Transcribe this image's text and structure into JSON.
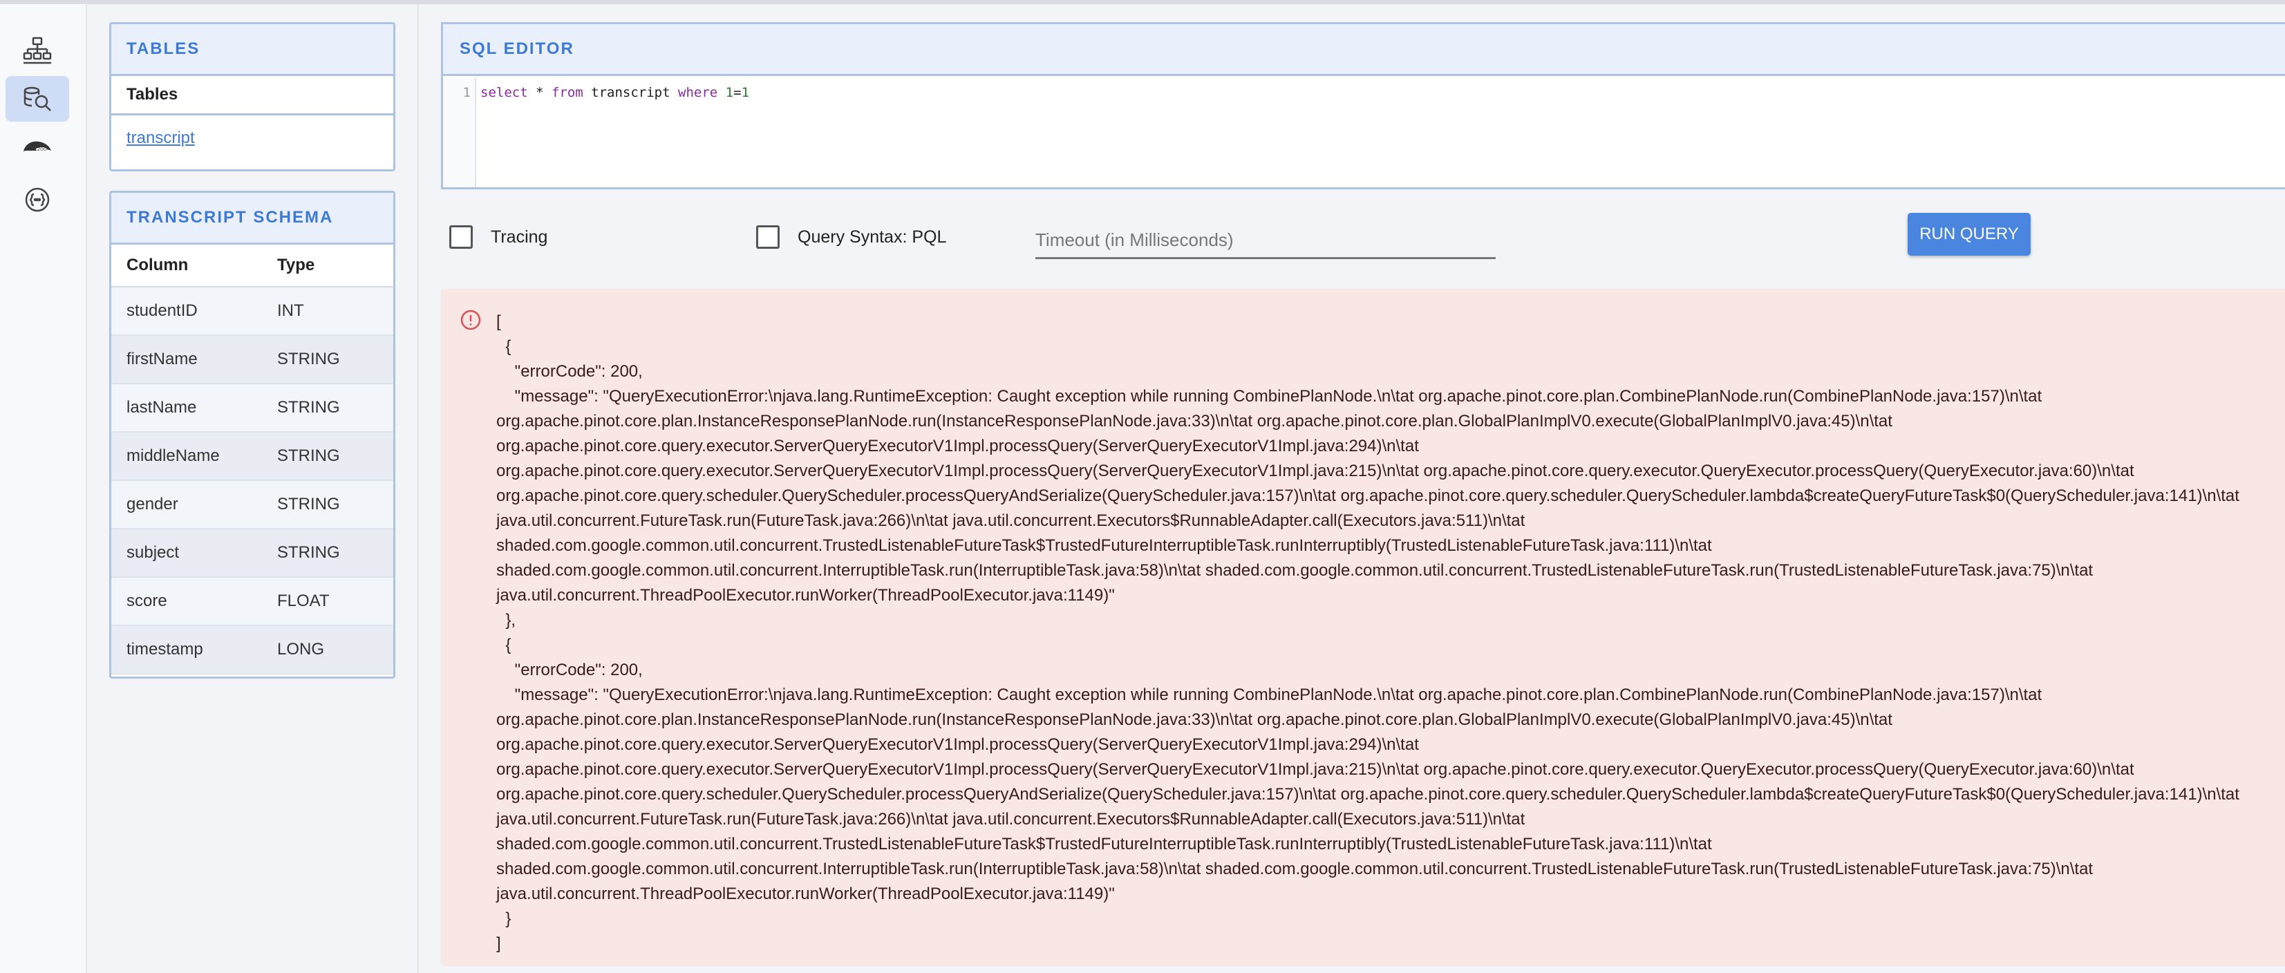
{
  "rail": {
    "items": [
      {
        "icon": "cluster-icon"
      },
      {
        "icon": "query-console-icon",
        "active": true
      },
      {
        "icon": "zookeeper-icon"
      },
      {
        "icon": "api-icon"
      }
    ]
  },
  "tables_panel": {
    "title": "TABLES",
    "subheader": "Tables",
    "items": [
      "transcript"
    ]
  },
  "schema_panel": {
    "title": "TRANSCRIPT SCHEMA",
    "columns": [
      "Column",
      "Type"
    ],
    "rows": [
      [
        "studentID",
        "INT"
      ],
      [
        "firstName",
        "STRING"
      ],
      [
        "lastName",
        "STRING"
      ],
      [
        "middleName",
        "STRING"
      ],
      [
        "gender",
        "STRING"
      ],
      [
        "subject",
        "STRING"
      ],
      [
        "score",
        "FLOAT"
      ],
      [
        "timestamp",
        "LONG"
      ]
    ]
  },
  "editor": {
    "title": "SQL EDITOR",
    "line_number": "1",
    "query": {
      "t1": "select",
      "t2": " * ",
      "t3": "from",
      "t4": " transcript ",
      "t5": "where",
      "t6": " ",
      "t7": "1",
      "t8": "=",
      "t9": "1"
    }
  },
  "options": {
    "tracing_label": "Tracing",
    "tracing_checked": false,
    "syntax_label": "Query Syntax: PQL",
    "syntax_checked": false,
    "timeout_placeholder": "Timeout (in Milliseconds)",
    "run_label": "RUN QUERY"
  },
  "error": {
    "icon": "error-circle-icon",
    "text": "[\n  {\n    \"errorCode\": 200,\n    \"message\": \"QueryExecutionError:\\njava.lang.RuntimeException: Caught exception while running CombinePlanNode.\\n\\tat org.apache.pinot.core.plan.CombinePlanNode.run(CombinePlanNode.java:157)\\n\\tat\norg.apache.pinot.core.plan.InstanceResponsePlanNode.run(InstanceResponsePlanNode.java:33)\\n\\tat org.apache.pinot.core.plan.GlobalPlanImplV0.execute(GlobalPlanImplV0.java:45)\\n\\tat\norg.apache.pinot.core.query.executor.ServerQueryExecutorV1Impl.processQuery(ServerQueryExecutorV1Impl.java:294)\\n\\tat\norg.apache.pinot.core.query.executor.ServerQueryExecutorV1Impl.processQuery(ServerQueryExecutorV1Impl.java:215)\\n\\tat org.apache.pinot.core.query.executor.QueryExecutor.processQuery(QueryExecutor.java:60)\\n\\tat\norg.apache.pinot.core.query.scheduler.QueryScheduler.processQueryAndSerialize(QueryScheduler.java:157)\\n\\tat org.apache.pinot.core.query.scheduler.QueryScheduler.lambda$createQueryFutureTask$0(QueryScheduler.java:141)\\n\\tat\njava.util.concurrent.FutureTask.run(FutureTask.java:266)\\n\\tat java.util.concurrent.Executors$RunnableAdapter.call(Executors.java:511)\\n\\tat\nshaded.com.google.common.util.concurrent.TrustedListenableFutureTask$TrustedFutureInterruptibleTask.runInterruptibly(TrustedListenableFutureTask.java:111)\\n\\tat\nshaded.com.google.common.util.concurrent.InterruptibleTask.run(InterruptibleTask.java:58)\\n\\tat shaded.com.google.common.util.concurrent.TrustedListenableFutureTask.run(TrustedListenableFutureTask.java:75)\\n\\tat\njava.util.concurrent.ThreadPoolExecutor.runWorker(ThreadPoolExecutor.java:1149)\"\n  },\n  {\n    \"errorCode\": 200,\n    \"message\": \"QueryExecutionError:\\njava.lang.RuntimeException: Caught exception while running CombinePlanNode.\\n\\tat org.apache.pinot.core.plan.CombinePlanNode.run(CombinePlanNode.java:157)\\n\\tat\norg.apache.pinot.core.plan.InstanceResponsePlanNode.run(InstanceResponsePlanNode.java:33)\\n\\tat org.apache.pinot.core.plan.GlobalPlanImplV0.execute(GlobalPlanImplV0.java:45)\\n\\tat\norg.apache.pinot.core.query.executor.ServerQueryExecutorV1Impl.processQuery(ServerQueryExecutorV1Impl.java:294)\\n\\tat\norg.apache.pinot.core.query.executor.ServerQueryExecutorV1Impl.processQuery(ServerQueryExecutorV1Impl.java:215)\\n\\tat org.apache.pinot.core.query.executor.QueryExecutor.processQuery(QueryExecutor.java:60)\\n\\tat\norg.apache.pinot.core.query.scheduler.QueryScheduler.processQueryAndSerialize(QueryScheduler.java:157)\\n\\tat org.apache.pinot.core.query.scheduler.QueryScheduler.lambda$createQueryFutureTask$0(QueryScheduler.java:141)\\n\\tat\njava.util.concurrent.FutureTask.run(FutureTask.java:266)\\n\\tat java.util.concurrent.Executors$RunnableAdapter.call(Executors.java:511)\\n\\tat\nshaded.com.google.common.util.concurrent.TrustedListenableFutureTask$TrustedFutureInterruptibleTask.runInterruptibly(TrustedListenableFutureTask.java:111)\\n\\tat\nshaded.com.google.common.util.concurrent.InterruptibleTask.run(InterruptibleTask.java:58)\\n\\tat shaded.com.google.common.util.concurrent.TrustedListenableFutureTask.run(TrustedListenableFutureTask.java:75)\\n\\tat\njava.util.concurrent.ThreadPoolExecutor.runWorker(ThreadPoolExecutor.java:1149)\"\n  }\n]"
  },
  "colors": {
    "accent": "#3d7ad6",
    "button": "#4a86e0",
    "error_bg": "#f8e7e5",
    "error_icon": "#d9534f"
  }
}
